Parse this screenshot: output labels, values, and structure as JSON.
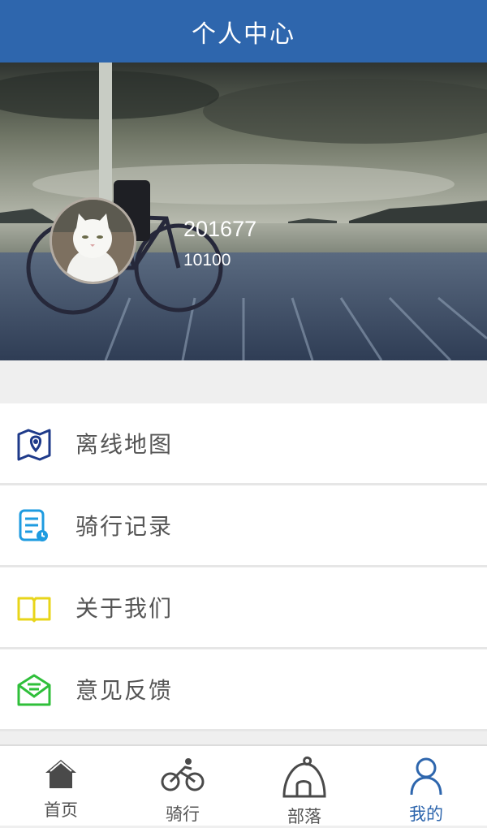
{
  "header": {
    "title": "个人中心"
  },
  "profile": {
    "user_id": "201677",
    "points": "10100"
  },
  "menu": [
    {
      "label": "离线地图",
      "icon": "map-pin-icon",
      "color": "#1e3a8a"
    },
    {
      "label": "骑行记录",
      "icon": "record-list-icon",
      "color": "#1e9be0"
    },
    {
      "label": "关于我们",
      "icon": "open-book-icon",
      "color": "#e8d51a"
    },
    {
      "label": "意见反馈",
      "icon": "envelope-icon",
      "color": "#2fbf3a"
    }
  ],
  "tabs": [
    {
      "label": "首页",
      "icon": "home-icon",
      "active": false
    },
    {
      "label": "骑行",
      "icon": "bicycle-icon",
      "active": false
    },
    {
      "label": "部落",
      "icon": "tent-icon",
      "active": false
    },
    {
      "label": "我的",
      "icon": "user-icon",
      "active": true
    }
  ],
  "colors": {
    "primary": "#2e66ad",
    "background": "#efefef"
  }
}
